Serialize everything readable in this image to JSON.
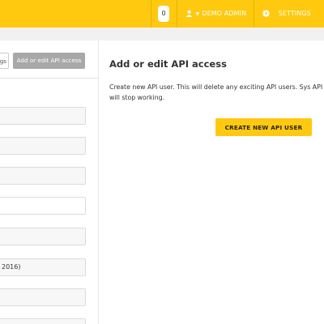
{
  "topbar": {
    "notification_count": "0",
    "user_label": "DEMO ADMIN",
    "settings_label": "SETTINGS",
    "accent_color": "#fec90f",
    "user_icon": "user-icon",
    "settings_icon": "gear-icon"
  },
  "left_panel": {
    "tab_partial_label": "gs",
    "tab_active_label": "Add or edit API access",
    "fields": [
      {
        "value": ""
      },
      {
        "value": ""
      },
      {
        "value": ""
      },
      {
        "value": ""
      },
      {
        "value": ""
      },
      {
        "value": "2016)"
      },
      {
        "value": ""
      },
      {
        "value": ""
      }
    ]
  },
  "main": {
    "title": "Add or edit API access",
    "description": "Create new API user. This will delete any exciting API users. Sys API users will stop working.",
    "create_button_label": "CREATE NEW API USER"
  }
}
